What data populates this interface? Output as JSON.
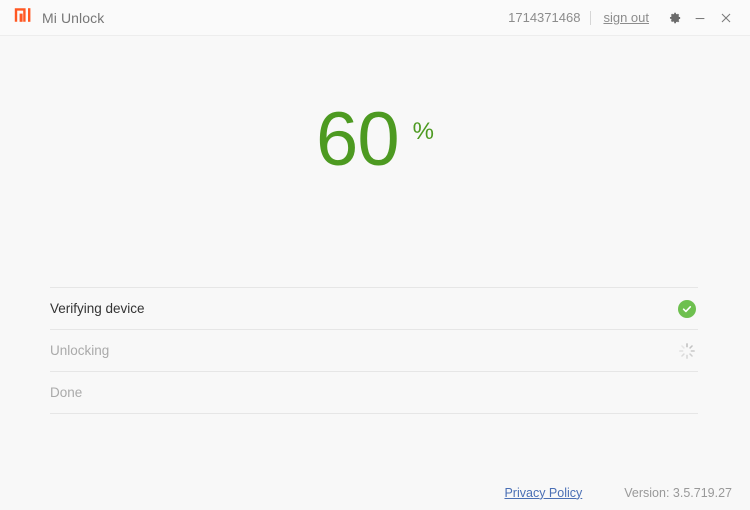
{
  "window": {
    "title": "Mi Unlock",
    "logo_icon": "mi-logo-icon",
    "background_color": "#f8f8f8"
  },
  "titlebar": {
    "account_id": "1714371468",
    "signout_label": "sign out",
    "settings_icon": "gear-icon",
    "minimize_icon": "minimize-icon",
    "close_icon": "close-icon"
  },
  "progress": {
    "value": "60",
    "unit": "%",
    "color": "#4d9a21"
  },
  "steps": [
    {
      "label": "Verifying device",
      "state": "complete",
      "status_icon": "check-circle-icon"
    },
    {
      "label": "Unlocking",
      "state": "in-progress",
      "status_icon": "spinner-icon"
    },
    {
      "label": "Done",
      "state": "pending",
      "status_icon": "none"
    }
  ],
  "footer": {
    "privacy_label": "Privacy Policy",
    "version_label": "Version: 3.5.719.27"
  }
}
